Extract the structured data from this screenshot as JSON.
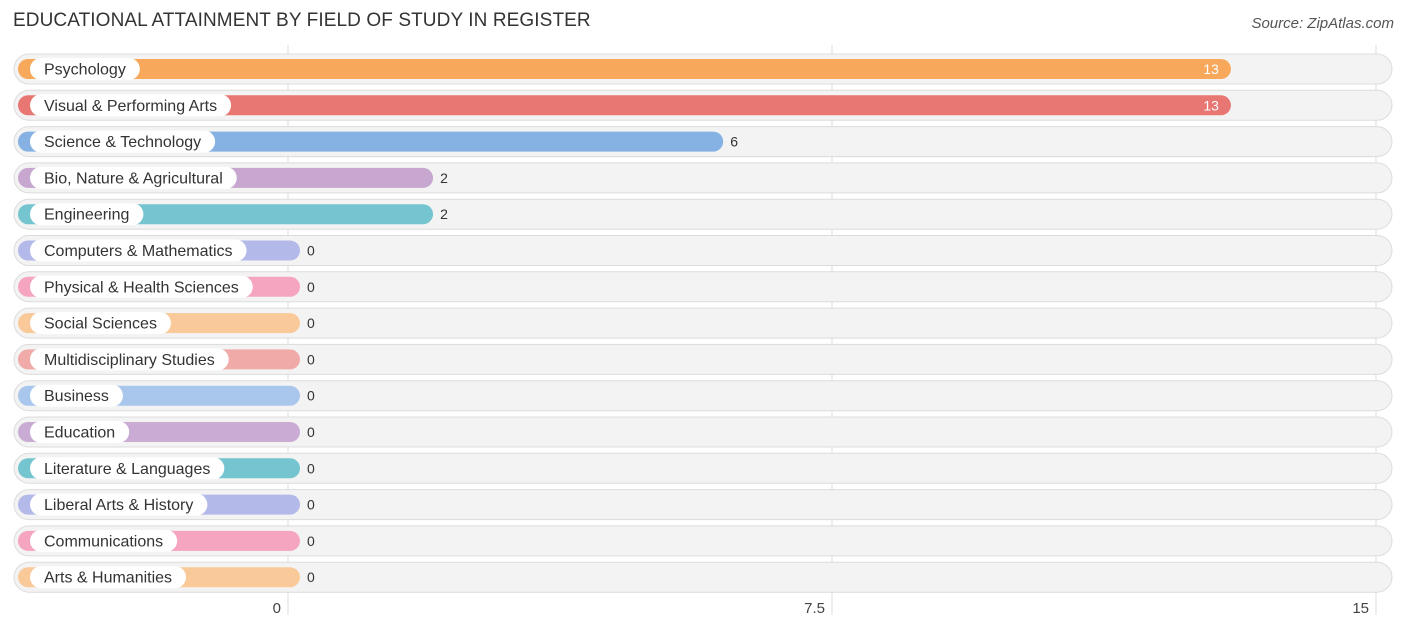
{
  "header": {
    "title": "EDUCATIONAL ATTAINMENT BY FIELD OF STUDY IN REGISTER",
    "source": "Source: ZipAtlas.com"
  },
  "chart_data": {
    "type": "bar",
    "orientation": "horizontal",
    "title": "EDUCATIONAL ATTAINMENT BY FIELD OF STUDY IN REGISTER",
    "xlabel": "",
    "ylabel": "",
    "xlim": [
      0,
      15
    ],
    "xticks": [
      0,
      7.5,
      15
    ],
    "xtick_labels": [
      "0",
      "7.5",
      "15"
    ],
    "grid": true,
    "categories": [
      "Psychology",
      "Visual & Performing Arts",
      "Science & Technology",
      "Bio, Nature & Agricultural",
      "Engineering",
      "Computers & Mathematics",
      "Physical & Health Sciences",
      "Social Sciences",
      "Multidisciplinary Studies",
      "Business",
      "Education",
      "Literature & Languages",
      "Liberal Arts & History",
      "Communications",
      "Arts & Humanities"
    ],
    "values": [
      13,
      13,
      6,
      2,
      2,
      0,
      0,
      0,
      0,
      0,
      0,
      0,
      0,
      0,
      0
    ],
    "value_labels": [
      "13",
      "13",
      "6",
      "2",
      "2",
      "0",
      "0",
      "0",
      "0",
      "0",
      "0",
      "0",
      "0",
      "0",
      "0"
    ],
    "colors": [
      "#f7a85a",
      "#e87672",
      "#86b2e3",
      "#c7a7cf",
      "#74c5cf",
      "#b3b9e9",
      "#f6a5c0",
      "#f9c999",
      "#f0aaa8",
      "#a9c6ec",
      "#c9abd3",
      "#74c5cf",
      "#b3b9e9",
      "#f6a5c0",
      "#f9c999"
    ]
  }
}
